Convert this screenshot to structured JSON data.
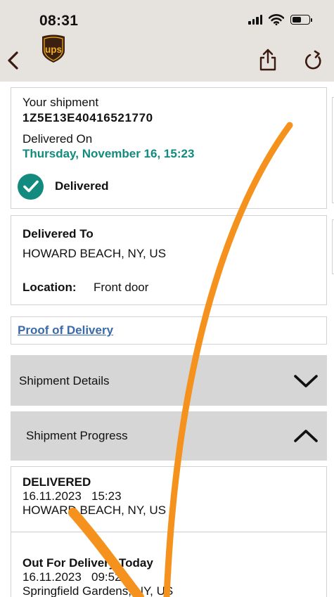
{
  "status_bar": {
    "time": "08:31"
  },
  "header": {
    "brand_logo_text": "ups"
  },
  "shipment": {
    "label": "Your shipment",
    "tracking_number": "1Z5E13E40416521770",
    "delivered_on_label": "Delivered On",
    "delivered_on_date": "Thursday, November 16, 15:23",
    "status": "Delivered"
  },
  "delivered_to": {
    "label": "Delivered To",
    "address": "HOWARD BEACH, NY, US",
    "location_label": "Location:",
    "location_value": "Front door"
  },
  "proof_of_delivery": {
    "label": "Proof of Delivery"
  },
  "sections": {
    "details_label": "Shipment Details",
    "progress_label": "Shipment Progress"
  },
  "progress": {
    "events": [
      {
        "status": "DELIVERED",
        "datetime": "16.11.2023   15:23",
        "location": "HOWARD BEACH, NY, US"
      },
      {
        "status": "Out For Delivery Today",
        "datetime": "16.11.2023   09:52",
        "location": "Springfield Gardens, NY, US"
      }
    ]
  },
  "colors": {
    "accent": "#128b7e",
    "link": "#3a6aa8",
    "header_bg": "#e6e2dd",
    "annotation": "#f5921e"
  }
}
